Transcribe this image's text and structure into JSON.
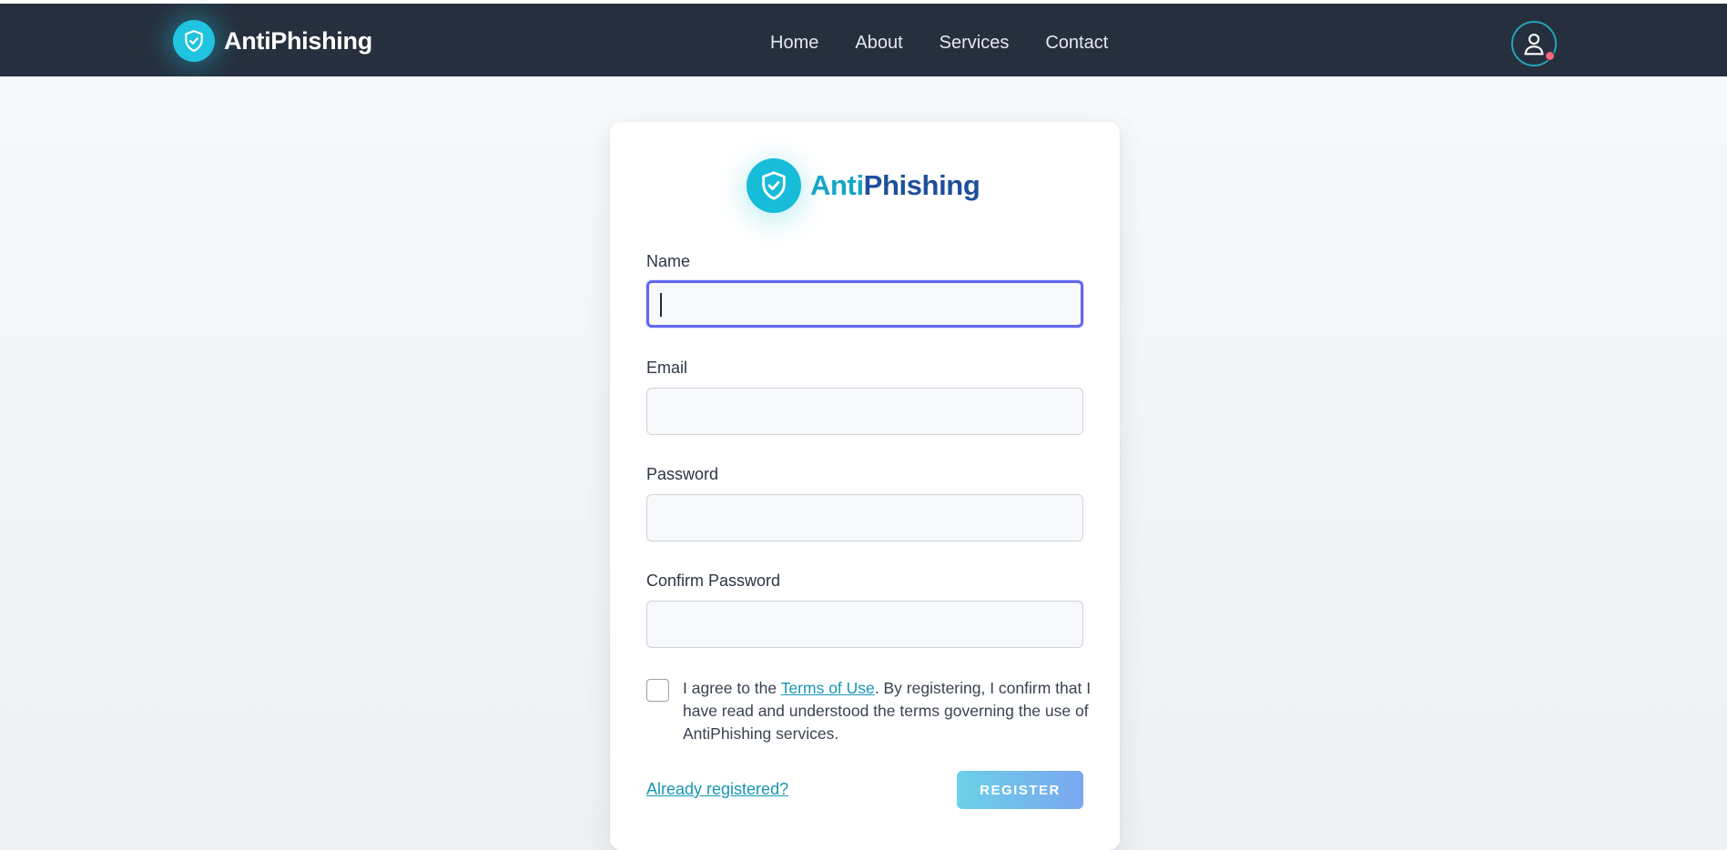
{
  "brand": {
    "name": "AntiPhishing",
    "name_part1": "Anti",
    "name_part2": "Phishing",
    "icon": "shield-check-icon"
  },
  "nav": {
    "links": [
      {
        "label": "Home"
      },
      {
        "label": "About"
      },
      {
        "label": "Services"
      },
      {
        "label": "Contact"
      }
    ]
  },
  "user": {
    "icon": "user-icon",
    "notification": "dot"
  },
  "form": {
    "name_label": "Name",
    "name_value": "",
    "email_label": "Email",
    "email_value": "",
    "password_label": "Password",
    "password_value": "",
    "confirm_label": "Confirm Password",
    "confirm_value": "",
    "agree_prefix": "I agree to the ",
    "terms_link": "Terms of Use",
    "agree_suffix": ". By registering, I confirm that I have read and understood the terms governing the use of AntiPhishing services.",
    "login_link": "Already registered?",
    "register_button": "REGISTER"
  },
  "colors": {
    "navbar": "#262f3d",
    "accent": "#17bcd8",
    "brand_dark": "#1d4f9c",
    "focus": "#6366f1",
    "link": "#1796b4",
    "notification": "#f2677e"
  }
}
